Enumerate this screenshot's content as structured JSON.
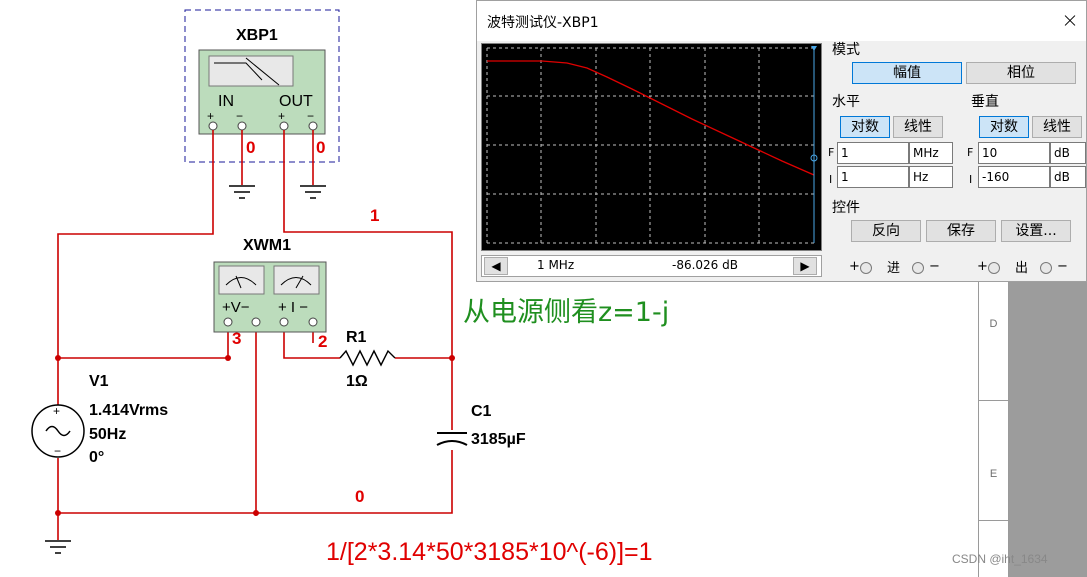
{
  "circuit": {
    "xbp_label": "XBP1",
    "xbp_in": "IN",
    "xbp_out": "OUT",
    "pin_plus": "+",
    "pin_minus": "−",
    "node0_a": "0",
    "node0_b": "0",
    "node1": "1",
    "node2": "2",
    "node3": "3",
    "node0_bottom": "0",
    "xwm_label": "XWM1",
    "xwm_v": "+V−",
    "xwm_i": "+ I −",
    "r1_name": "R1",
    "r1_value": "1Ω",
    "c1_name": "C1",
    "c1_value": "3185µF",
    "v1_name": "V1",
    "v1_amp": "1.414Vrms",
    "v1_freq": "50Hz",
    "v1_phase": "0°",
    "src_plus": "+",
    "src_minus": "−",
    "note_impedance": "从电源侧看z=1-j",
    "note_formula": "1/[2*3.14*50*3185*10^(-6)]=1"
  },
  "ruler": {
    "labels": [
      "D",
      "E"
    ]
  },
  "watermark": "CSDN @iht_1634",
  "bode": {
    "title": "波特测试仪-XBP1",
    "mode_label": "模式",
    "btn_magnitude": "幅值",
    "btn_phase": "相位",
    "horizontal_label": "水平",
    "vertical_label": "垂直",
    "btn_log_h": "对数",
    "btn_lin_h": "线性",
    "btn_log_v": "对数",
    "btn_lin_v": "线性",
    "h_final": {
      "prefix": "F",
      "value": "1",
      "unit": "MHz"
    },
    "h_initial": {
      "prefix": "I",
      "value": "1",
      "unit": "Hz"
    },
    "v_final": {
      "prefix": "F",
      "value": "10",
      "unit": "dB"
    },
    "v_initial": {
      "prefix": "I",
      "value": "-160",
      "unit": "dB"
    },
    "controls_label": "控件",
    "btn_reverse": "反向",
    "btn_save": "保存",
    "btn_settings": "设置...",
    "readout_freq": "1 MHz",
    "readout_mag": "-86.026 dB",
    "in_label": "进",
    "out_label": "出",
    "plus": "+",
    "minus": "−",
    "colors": {
      "trace": "#e00000",
      "screen": "#000000",
      "grid": "#c0c0c0"
    }
  }
}
